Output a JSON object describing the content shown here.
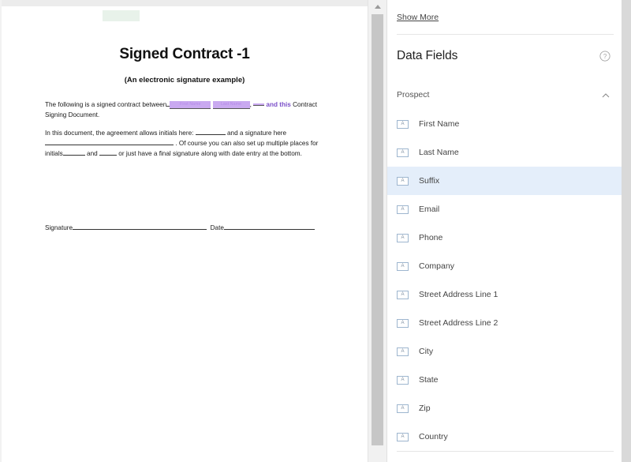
{
  "document": {
    "title": "Signed Contract -1",
    "subtitle": "(An electronic signature example)",
    "green_highlight_color": "#e8f2ea",
    "paragraph1": {
      "lead": "The following is a signed contract between",
      "chip_first_name": "First Name",
      "chip_last_name": "Last Name",
      "comma": ",",
      "purple_text": "and this",
      "tail": "Contract Signing Document."
    },
    "paragraph2": {
      "part1": "In this document, the agreement allows initials here:",
      "part2": "and a signature here",
      "part3": ". Of course you can also set up multiple places for initials",
      "part4": "and",
      "part5": "or just have a final signature along with date entry at the bottom."
    },
    "signature_label": "Signature",
    "date_label": "Date",
    "chip_color": "#c9a9f0",
    "purple_color": "#7b4fc9"
  },
  "panel": {
    "show_more_label": "Show More",
    "title": "Data Fields",
    "help_icon": "question-circle-icon",
    "group": {
      "label": "Prospect",
      "chevron": "chevron-up-icon",
      "expanded": true
    },
    "field_icon_glyph": "A",
    "selected_field": "Suffix",
    "fields": [
      {
        "label": "First Name",
        "icon": "text-field-icon"
      },
      {
        "label": "Last Name",
        "icon": "text-field-icon"
      },
      {
        "label": "Suffix",
        "icon": "text-field-icon"
      },
      {
        "label": "Email",
        "icon": "text-field-icon"
      },
      {
        "label": "Phone",
        "icon": "text-field-icon"
      },
      {
        "label": "Company",
        "icon": "text-field-icon"
      },
      {
        "label": "Street Address Line 1",
        "icon": "text-field-icon"
      },
      {
        "label": "Street Address Line 2",
        "icon": "text-field-icon"
      },
      {
        "label": "City",
        "icon": "text-field-icon"
      },
      {
        "label": "State",
        "icon": "text-field-icon"
      },
      {
        "label": "Zip",
        "icon": "text-field-icon"
      },
      {
        "label": "Country",
        "icon": "text-field-icon"
      }
    ],
    "selection_color": "#e4eefa"
  },
  "scrollbar": {
    "up_arrow": "caret-up-icon"
  }
}
